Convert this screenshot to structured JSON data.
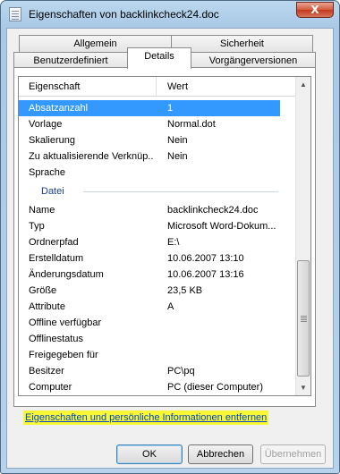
{
  "window": {
    "title": "Eigenschaften von backlinkcheck24.doc",
    "close": "X"
  },
  "tabs": {
    "row1": [
      "Allgemein",
      "Sicherheit"
    ],
    "row2": [
      "Benutzerdefiniert",
      "Details",
      "Vorgängerversionen"
    ],
    "active": "Details"
  },
  "list": {
    "headers": {
      "property": "Eigenschaft",
      "value": "Wert"
    },
    "rows_top": [
      {
        "k": "Absatzanzahl",
        "v": "1",
        "selected": true
      },
      {
        "k": "Vorlage",
        "v": "Normal.dot"
      },
      {
        "k": "Skalierung",
        "v": "Nein"
      },
      {
        "k": "Zu aktualisierende Verknüp...",
        "v": "Nein"
      },
      {
        "k": "Sprache",
        "v": ""
      }
    ],
    "group_label": "Datei",
    "rows_file": [
      {
        "k": "Name",
        "v": "backlinkcheck24.doc"
      },
      {
        "k": "Typ",
        "v": "Microsoft Word-Dokum..."
      },
      {
        "k": "Ordnerpfad",
        "v": "E:\\"
      },
      {
        "k": "Erstelldatum",
        "v": "10.06.2007 13:10"
      },
      {
        "k": "Änderungsdatum",
        "v": "10.06.2007 13:16"
      },
      {
        "k": "Größe",
        "v": "23,5 KB"
      },
      {
        "k": "Attribute",
        "v": "A"
      },
      {
        "k": "Offline verfügbar",
        "v": ""
      },
      {
        "k": "Offlinestatus",
        "v": ""
      },
      {
        "k": "Freigegeben für",
        "v": ""
      },
      {
        "k": "Besitzer",
        "v": "PC\\pq"
      },
      {
        "k": "Computer",
        "v": "PC (dieser Computer)"
      }
    ]
  },
  "link": "Eigenschaften und persönliche Informationen entfernen",
  "buttons": {
    "ok": "OK",
    "cancel": "Abbrechen",
    "apply": "Übernehmen"
  },
  "colors": {
    "selection": "#3399ff",
    "link_highlight": "#f7f735",
    "link": "#0044cc"
  }
}
